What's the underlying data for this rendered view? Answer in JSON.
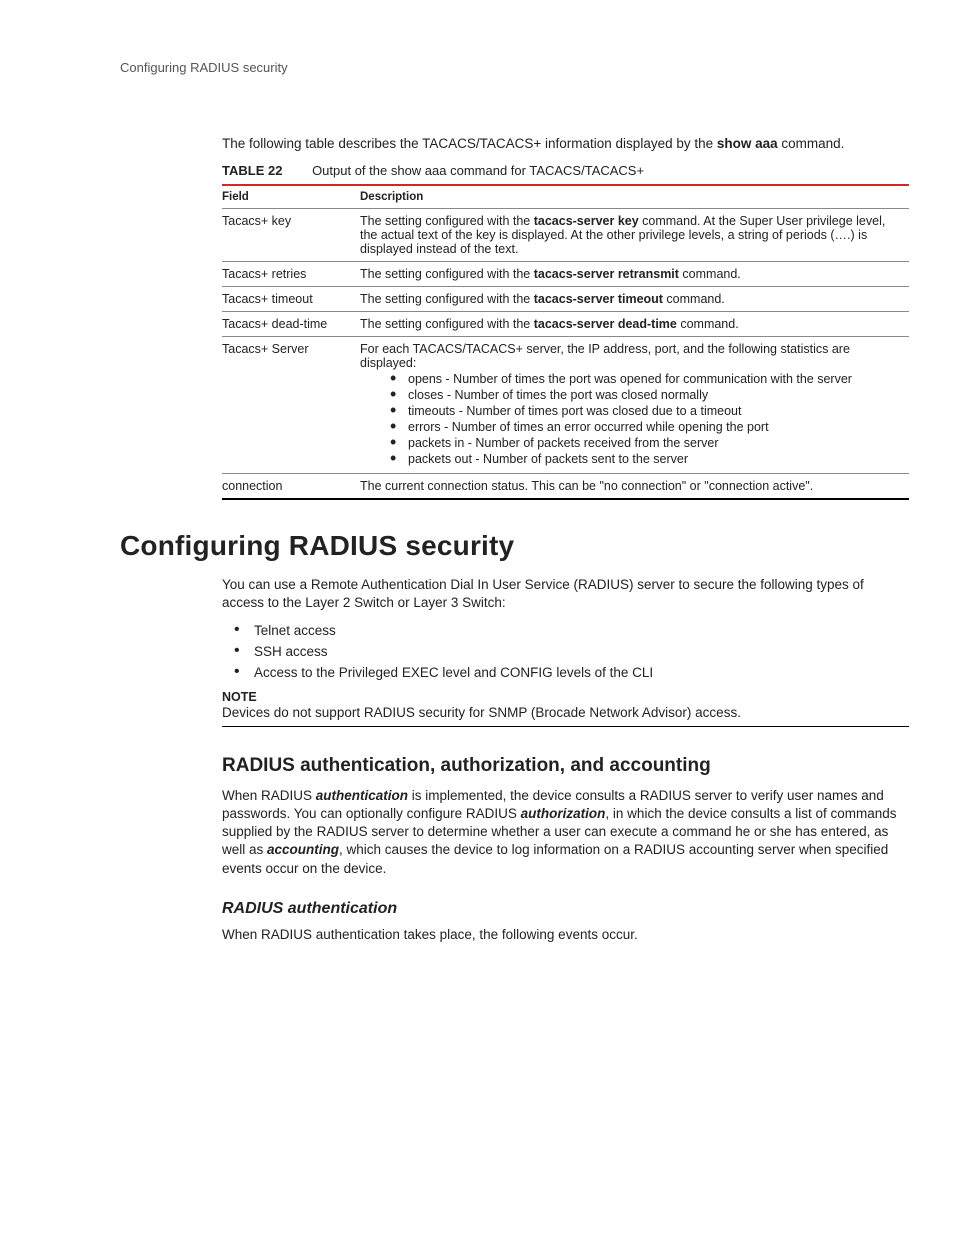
{
  "runningHead": "Configuring RADIUS security",
  "intro": {
    "pre": "The following table describes the TACACS/TACACS+ information displayed by the ",
    "cmd": "show aaa",
    "post": " command."
  },
  "tableCaption": {
    "label": "TABLE 22",
    "title": "Output of the show aaa command for TACACS/TACACS+"
  },
  "tableHeaders": [
    "Field",
    "Description"
  ],
  "rows": [
    {
      "field": "Tacacs+ key",
      "desc": {
        "t1": "The setting configured with the ",
        "b1": "tacacs-server key",
        "t2": " command. At the Super User privilege level, the actual text of the key is displayed. At the other privilege levels, a string of periods (….) is displayed instead of the text."
      }
    },
    {
      "field": "Tacacs+ retries",
      "desc": {
        "t1": "The setting configured with the ",
        "b1": "tacacs-server retransmit",
        "t2": " command."
      }
    },
    {
      "field": "Tacacs+ timeout",
      "desc": {
        "t1": "The setting configured with the ",
        "b1": "tacacs-server timeout",
        "t2": " command."
      }
    },
    {
      "field": "Tacacs+ dead-time",
      "desc": {
        "t1": "The setting configured with the ",
        "b1": "tacacs-server dead-time",
        "t2": " command."
      }
    }
  ],
  "serverRow": {
    "field": "Tacacs+ Server",
    "lead": "For each TACACS/TACACS+ server, the IP address, port, and the following statistics are displayed:",
    "bullets": [
      "opens - Number of times the port was opened for communication with the server",
      "closes - Number of times the port was closed normally",
      "timeouts - Number of times port was closed due to a timeout",
      "errors - Number of times an error occurred while opening the port",
      "packets in - Number of packets received from the server",
      "packets out - Number of packets sent to the server"
    ]
  },
  "connRow": {
    "field": "connection",
    "desc": "The current connection status. This can be \"no connection\" or \"connection active\"."
  },
  "h1": "Configuring RADIUS security",
  "radiusIntro": "You can use a Remote Authentication Dial In User Service (RADIUS) server to secure the following types of access to the Layer 2 Switch or Layer 3 Switch:",
  "accessList": [
    "Telnet access",
    "SSH access",
    "Access to the Privileged EXEC level and CONFIG levels of the CLI"
  ],
  "note": {
    "label": "NOTE",
    "text": "Devices do not support RADIUS security for SNMP (Brocade Network Advisor) access."
  },
  "h2": "RADIUS authentication, authorization, and accounting",
  "aaa": {
    "s1": "When RADIUS ",
    "b1": "authentication",
    "s2": " is implemented, the device consults a RADIUS server to verify user names and passwords. You can optionally configure RADIUS ",
    "b2": "authorization",
    "s3": ", in which the device consults a list of commands supplied by the RADIUS server to determine whether a user can execute a command he or she has entered, as well as ",
    "b3": "accounting",
    "s4": ", which causes the device to log information on a RADIUS accounting server when specified events occur on the device."
  },
  "h3": "RADIUS authentication",
  "authPara": "When RADIUS authentication takes place, the following events occur."
}
